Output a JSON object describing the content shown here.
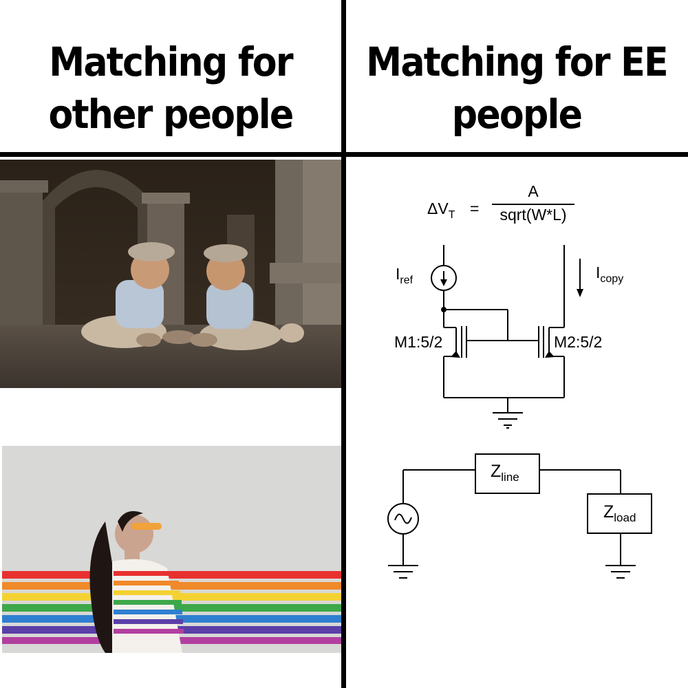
{
  "meme": {
    "left_heading": {
      "line1": "Matching for",
      "line2": "other people"
    },
    "right_heading": {
      "line1": "Matching for EE",
      "line2": "people"
    }
  },
  "photos": [
    {
      "name": "twin-babies-photo"
    },
    {
      "name": "rainbow-wall-photo"
    }
  ],
  "formula": {
    "lhs_delta": "ΔV",
    "lhs_sub": "T",
    "equals": "=",
    "numerator": "A",
    "denominator": "sqrt(W*L)"
  },
  "current_mirror": {
    "iref_label": "I",
    "iref_sub": "ref",
    "icopy_label": "I",
    "icopy_sub": "copy",
    "m1_label": "M1:5/2",
    "m2_label": "M2:5/2"
  },
  "impedance_circuit": {
    "zline_label": "Z",
    "zline_sub": "line",
    "zload_label": "Z",
    "zload_sub": "load"
  },
  "colors": {
    "divider": "#000000",
    "background": "#ffffff",
    "rainbow": [
      "#e8312f",
      "#f08a2a",
      "#f4d233",
      "#3da84a",
      "#2f7fd1",
      "#5b3fa8",
      "#b23fa0"
    ]
  }
}
